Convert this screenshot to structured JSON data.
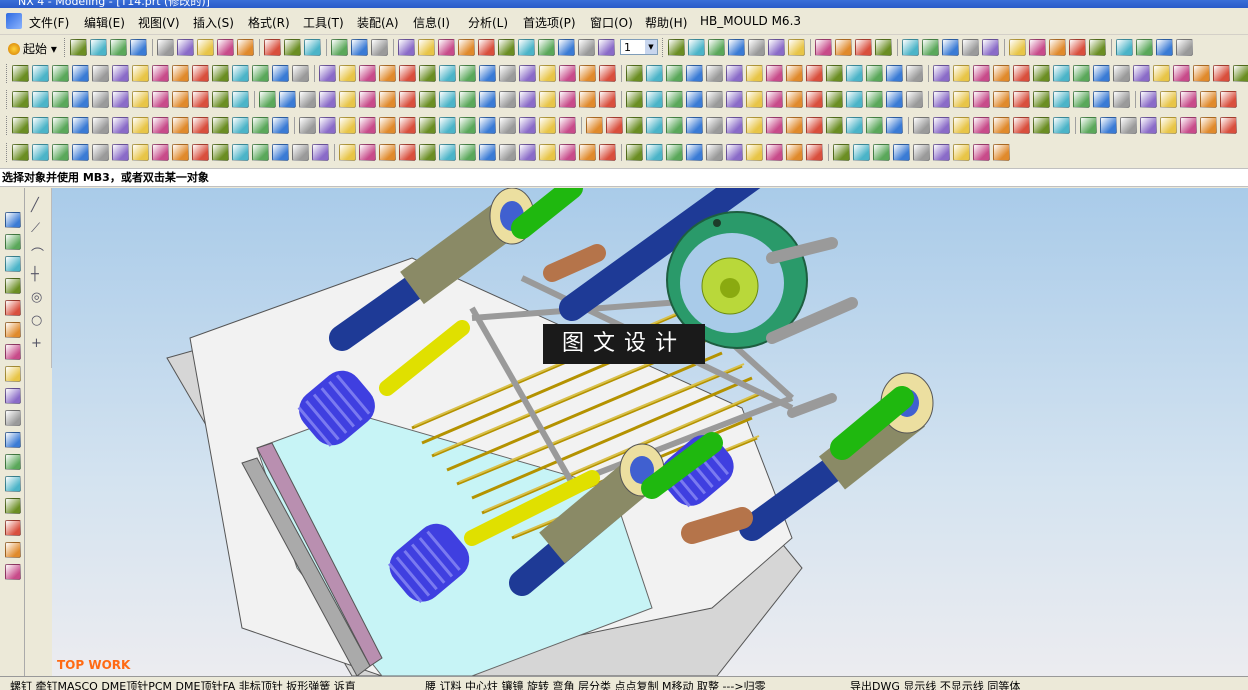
{
  "window": {
    "title": "NX 4 - Modeling - [T14.prt (修改的)]"
  },
  "menu": {
    "file": "文件(F)",
    "edit": "编辑(E)",
    "view": "视图(V)",
    "insert": "插入(S)",
    "format": "格式(R)",
    "tools": "工具(T)",
    "assembly": "装配(A)",
    "info": "信息(I)",
    "analysis": "分析(L)",
    "preferences": "首选项(P)",
    "window": "窗口(O)",
    "help": "帮助(H)",
    "plugin": "HB_MOULD M6.3"
  },
  "toolbar": {
    "start_label": "起始",
    "layer_value": "1"
  },
  "status": {
    "prompt": "选择对象并使用 MB3，或者双击某一对象"
  },
  "viewport": {
    "corner_label": "TOP WORK",
    "watermark": "图文设计"
  },
  "bottom_bar": {
    "left_text": "螺钉  牵钉MASCO  DME顶针PCM  DME顶针FA  非标顶针  扳形弹簧  诉直",
    "right_text": "腰  订料  中心炷  镶镜  旋转  弯角  层分类  点点复制  M移动  取整  --->归零",
    "extra_text": "导出DWG  显示线  不显示线  同等体"
  },
  "colors": {
    "viewport_top": "#a9cbe9",
    "viewport_bottom": "#ececf0",
    "mould_plate": "#f2f2f2",
    "mould_cavity": "#c7f4f6",
    "guide_pillar": "#1e3a96",
    "bushing": "#8a8a66",
    "spring": "#4a4ad6",
    "locating_ring": "#2a9a6a",
    "ejector_pin": "#c8a800",
    "green_screw": "#1fb80f",
    "watermark_bg": "#1a1a1a",
    "corner_label": "#ff6a13"
  }
}
